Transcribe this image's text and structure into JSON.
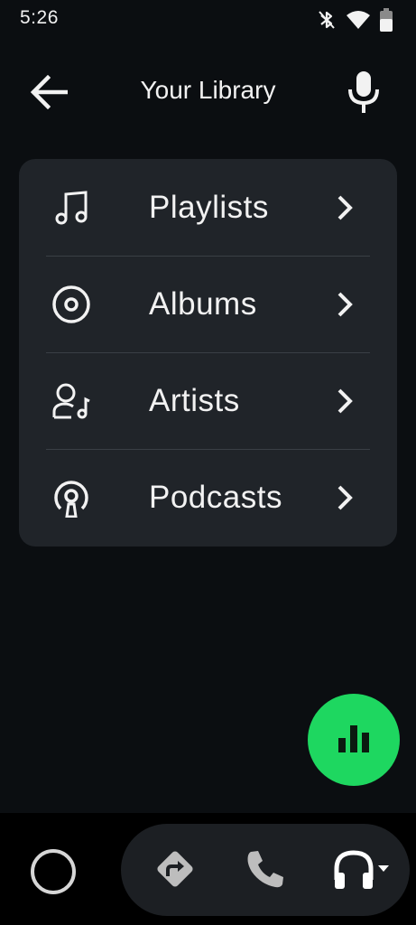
{
  "status_bar": {
    "time": "5:26",
    "icons": [
      "bluetooth-icon",
      "wifi-icon",
      "battery-icon"
    ]
  },
  "header": {
    "title": "Your Library",
    "back_icon": "arrow-left-icon",
    "mic_icon": "microphone-icon"
  },
  "library": {
    "items": [
      {
        "label": "Playlists",
        "icon": "music-note-icon"
      },
      {
        "label": "Albums",
        "icon": "album-disc-icon"
      },
      {
        "label": "Artists",
        "icon": "artist-icon"
      },
      {
        "label": "Podcasts",
        "icon": "podcast-icon"
      }
    ]
  },
  "fab": {
    "icon": "equalizer-bars-icon",
    "color": "#1ED760"
  },
  "nav": {
    "items": [
      "home-circle-icon",
      "navigation-directions-icon",
      "phone-icon",
      "headphones-icon"
    ]
  },
  "colors": {
    "background": "#0B0E11",
    "card": "#202429",
    "accent": "#1ED760"
  }
}
